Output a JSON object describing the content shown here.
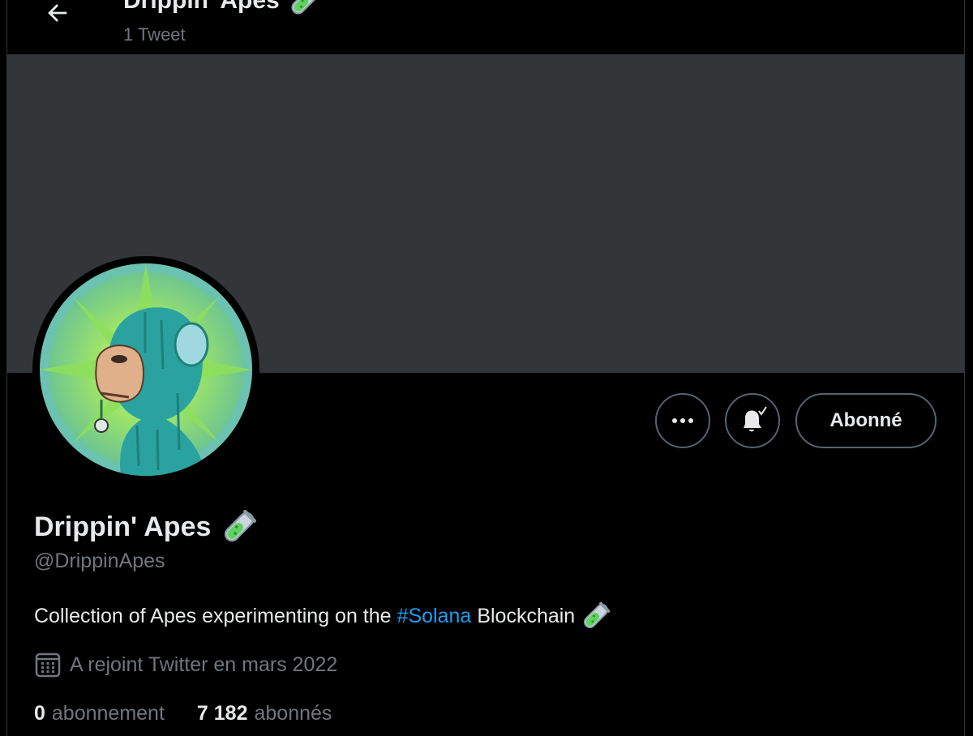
{
  "header": {
    "name": "Drippin' Apes",
    "tweet_count": "1 Tweet"
  },
  "profile": {
    "display_name": "Drippin' Apes",
    "handle": "@DrippinApes",
    "bio": {
      "before": "Collection of Apes experimenting on the",
      "hashtag": "#Solana",
      "after": "Blockchain"
    },
    "joined": "A rejoint Twitter en mars 2022",
    "stats": {
      "following_count": "0",
      "following_label": "abonnement",
      "followers_count": "7 182",
      "followers_label": "abonnés"
    }
  },
  "actions": {
    "follow_label": "Abonné",
    "more_icon": "more-dots-icon",
    "bell_icon": "bell-check-icon"
  },
  "colors": {
    "background": "#000000",
    "banner": "#333639",
    "text_primary": "#e7e9ea",
    "text_secondary": "#71767b",
    "accent": "#1d9bf0",
    "border": "#536471"
  }
}
